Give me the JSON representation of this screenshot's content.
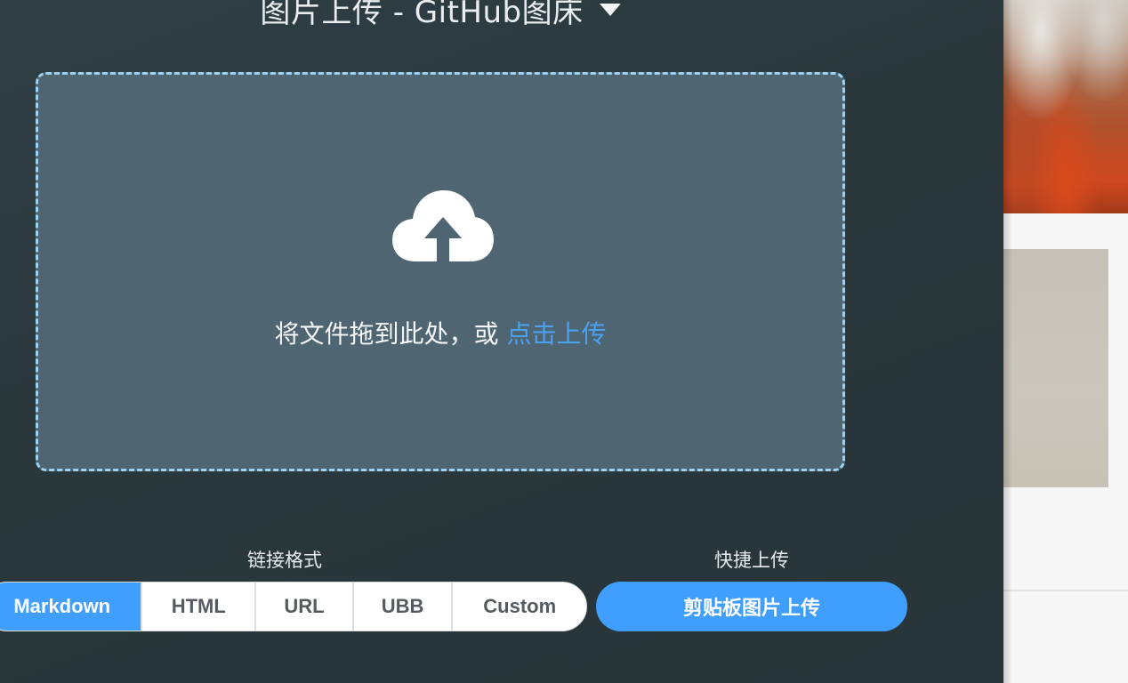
{
  "header": {
    "title": "图片上传 - GitHub图床"
  },
  "dropzone": {
    "text": "将文件拖到此处，或 ",
    "link": "点击上传",
    "icon": "cloud-upload-icon"
  },
  "link_format": {
    "label": "链接格式",
    "options": [
      "Markdown",
      "HTML",
      "URL",
      "UBB",
      "Custom"
    ],
    "selected": "Markdown"
  },
  "quick_upload": {
    "label": "快捷上传",
    "button": "剪贴板图片上传"
  },
  "colors": {
    "accent": "#409eff",
    "panel": "#2b3a3f",
    "dropzone_bg": "#4f6571",
    "dropzone_border": "#9cd3f5"
  }
}
